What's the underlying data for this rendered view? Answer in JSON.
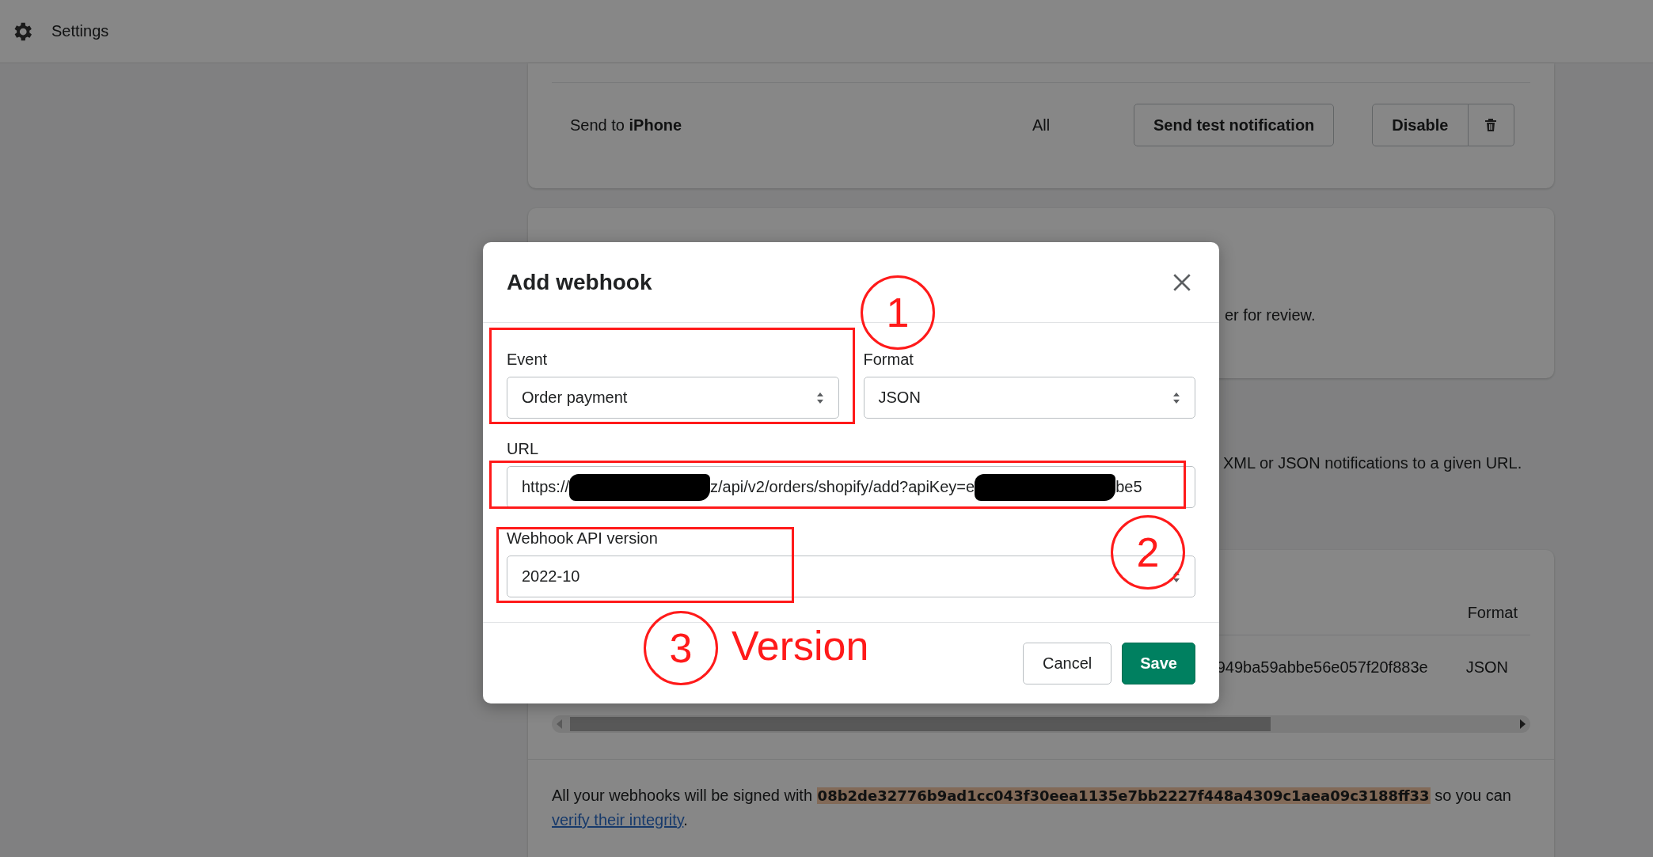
{
  "top_bar": {
    "title": "Settings"
  },
  "notification_row": {
    "text": "Send to **iPhone**",
    "scope": "All",
    "test_button": "Send test notification",
    "disable_button": "Disable"
  },
  "draft_orders_card": {
    "visible_text": "er for review."
  },
  "webhooks_intro": {
    "visible_text": "XML or JSON notifications to a given URL."
  },
  "webhooks_table": {
    "columns": [
      "Format"
    ],
    "rows": [
      {
        "key_fragment": "949ba59abbe56e057f20f883e",
        "format": "JSON"
      }
    ]
  },
  "signing_note": {
    "before": "All your webhooks will be signed with ",
    "secret": "08b2de32776b9ad1cc043f30eea1135e7bb2227f448a4309c1aea09c3188ff33",
    "after": " so you can ",
    "link": "verify their integrity",
    "end": "."
  },
  "dialog": {
    "title": "Add webhook",
    "event": {
      "label": "Event",
      "value": "Order payment"
    },
    "format": {
      "label": "Format",
      "value": "JSON"
    },
    "url": {
      "label": "URL",
      "parts": [
        {
          "kind": "text",
          "text": "https://"
        },
        {
          "kind": "redacted"
        },
        {
          "kind": "text",
          "text": "z/api/v2/orders/shopify/add?apiKey=e"
        },
        {
          "kind": "redacted"
        },
        {
          "kind": "text",
          "text": "be5"
        }
      ]
    },
    "api_version": {
      "label": "Webhook API version",
      "value": "2022-10"
    },
    "cancel_button": "Cancel",
    "save_button": "Save"
  },
  "annotations": [
    {
      "kind": "frame"
    },
    {
      "kind": "circle",
      "label": "1"
    },
    {
      "kind": "frame"
    },
    {
      "kind": "circle",
      "label": "2"
    },
    {
      "kind": "frame"
    },
    {
      "kind": "circle",
      "label": "3"
    },
    {
      "kind": "note",
      "label": "Version"
    }
  ]
}
